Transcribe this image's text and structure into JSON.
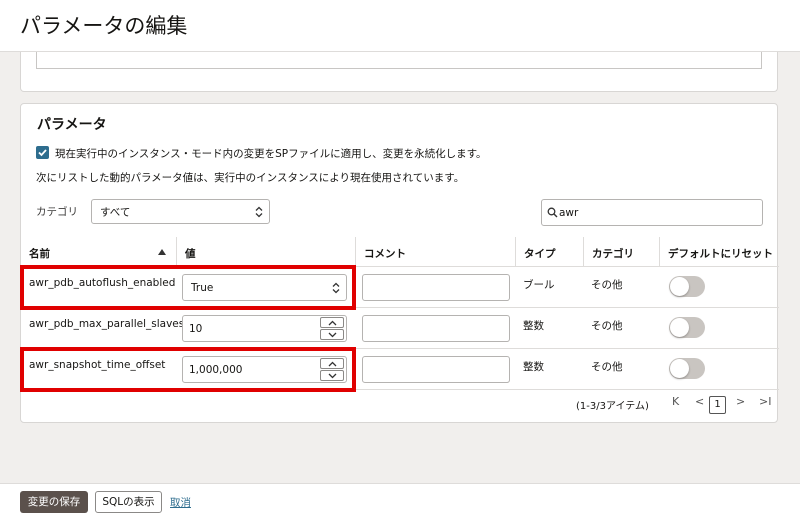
{
  "header": {
    "title": "パラメータの編集"
  },
  "section": {
    "title": "パラメータ",
    "checkbox_label": "現在実行中のインスタンス・モード内の変更をSPファイルに適用し、変更を永続化します。",
    "info": "次にリストした動的パラメータ値は、実行中のインスタンスにより現在使用されています。"
  },
  "filter": {
    "category_label": "カテゴリ",
    "category_value": "すべて",
    "search_value": "awr"
  },
  "table": {
    "headers": {
      "name": "名前",
      "value": "値",
      "comment": "コメント",
      "type": "タイプ",
      "category": "カテゴリ",
      "reset": "デフォルトにリセット"
    },
    "rows": [
      {
        "name": "awr_pdb_autoflush_enabled",
        "value": "True",
        "type": "ブール",
        "category": "その他"
      },
      {
        "name": "awr_pdb_max_parallel_slaves",
        "value": "10",
        "type": "整数",
        "category": "その他"
      },
      {
        "name": "awr_snapshot_time_offset",
        "value": "1,000,000",
        "type": "整数",
        "category": "その他"
      }
    ]
  },
  "pagination": {
    "summary": "(1-3/3アイテム)",
    "first": "K",
    "prev": "<",
    "current": "1",
    "next": ">",
    "last": ">I"
  },
  "footer": {
    "save": "変更の保存",
    "show_sql": "SQLの表示",
    "cancel": "取消"
  },
  "colors": {
    "primary_button": "#5b514c",
    "checkbox": "#2e6d8e",
    "highlight": "#e00000",
    "link": "#2e6d8e"
  }
}
